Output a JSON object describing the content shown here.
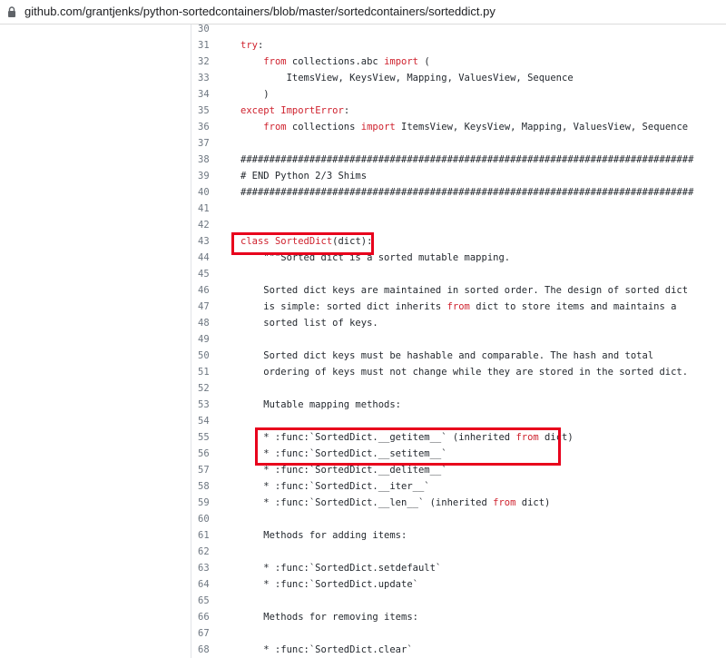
{
  "browser": {
    "url": "github.com/grantjenks/python-sortedcontainers/blob/master/sortedcontainers/sorteddict.py",
    "lock_icon": "lock-icon"
  },
  "code_lines": [
    {
      "n": "30",
      "text": ""
    },
    {
      "n": "31",
      "text": "try:"
    },
    {
      "n": "32",
      "text": "    from collections.abc import ("
    },
    {
      "n": "33",
      "text": "        ItemsView, KeysView, Mapping, ValuesView, Sequence"
    },
    {
      "n": "34",
      "text": "    )"
    },
    {
      "n": "35",
      "text": "except ImportError:"
    },
    {
      "n": "36",
      "text": "    from collections import ItemsView, KeysView, Mapping, ValuesView, Sequence"
    },
    {
      "n": "37",
      "text": ""
    },
    {
      "n": "38",
      "text": "###############################################################################"
    },
    {
      "n": "39",
      "text": "# END Python 2/3 Shims"
    },
    {
      "n": "40",
      "text": "###############################################################################"
    },
    {
      "n": "41",
      "text": ""
    },
    {
      "n": "42",
      "text": ""
    },
    {
      "n": "43",
      "text": "class SortedDict(dict):"
    },
    {
      "n": "44",
      "text": "    \"\"\"Sorted dict is a sorted mutable mapping."
    },
    {
      "n": "45",
      "text": ""
    },
    {
      "n": "46",
      "text": "    Sorted dict keys are maintained in sorted order. The design of sorted dict"
    },
    {
      "n": "47",
      "text": "    is simple: sorted dict inherits from dict to store items and maintains a"
    },
    {
      "n": "48",
      "text": "    sorted list of keys."
    },
    {
      "n": "49",
      "text": ""
    },
    {
      "n": "50",
      "text": "    Sorted dict keys must be hashable and comparable. The hash and total"
    },
    {
      "n": "51",
      "text": "    ordering of keys must not change while they are stored in the sorted dict."
    },
    {
      "n": "52",
      "text": ""
    },
    {
      "n": "53",
      "text": "    Mutable mapping methods:"
    },
    {
      "n": "54",
      "text": ""
    },
    {
      "n": "55",
      "text": "    * :func:`SortedDict.__getitem__` (inherited from dict)"
    },
    {
      "n": "56",
      "text": "    * :func:`SortedDict.__setitem__`"
    },
    {
      "n": "57",
      "text": "    * :func:`SortedDict.__delitem__`"
    },
    {
      "n": "58",
      "text": "    * :func:`SortedDict.__iter__`"
    },
    {
      "n": "59",
      "text": "    * :func:`SortedDict.__len__` (inherited from dict)"
    },
    {
      "n": "60",
      "text": ""
    },
    {
      "n": "61",
      "text": "    Methods for adding items:"
    },
    {
      "n": "62",
      "text": ""
    },
    {
      "n": "63",
      "text": "    * :func:`SortedDict.setdefault`"
    },
    {
      "n": "64",
      "text": "    * :func:`SortedDict.update`"
    },
    {
      "n": "65",
      "text": ""
    },
    {
      "n": "66",
      "text": "    Methods for removing items:"
    },
    {
      "n": "67",
      "text": ""
    },
    {
      "n": "68",
      "text": "    * :func:`SortedDict.clear`"
    }
  ],
  "colors": {
    "keyword": "#cf222e",
    "highlight_box": "#e8001c",
    "line_number": "#6e7781"
  }
}
